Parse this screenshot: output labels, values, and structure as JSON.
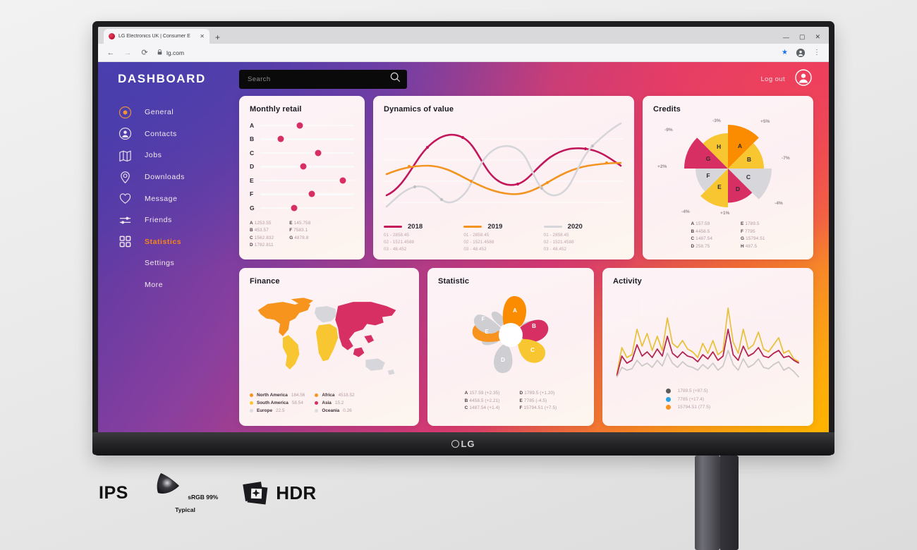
{
  "browser": {
    "tab_title": "LG Electronics UK | Consumer E",
    "tab_close": "✕",
    "new_tab": "+",
    "url": "lg.com",
    "back_icon": "←",
    "forward_icon": "→",
    "reload_icon": "⟳",
    "lock_icon": "🔒",
    "minimize": "—",
    "maximize": "▢",
    "close": "✕",
    "star_icon": "★",
    "menu_icon": "⋮"
  },
  "monitor": {
    "brand": "LG"
  },
  "header": {
    "title": "DASHBOARD",
    "search_placeholder": "Search",
    "search_value": "",
    "search_icon": "search-icon",
    "logout_label": "Log out",
    "avatar_icon": "user-avatar-icon"
  },
  "sidebar": {
    "items": [
      {
        "label": "General",
        "icon": "target-icon",
        "active": false
      },
      {
        "label": "Contacts",
        "icon": "contact-icon",
        "active": false
      },
      {
        "label": "Jobs",
        "icon": "map-icon",
        "active": false
      },
      {
        "label": "Downloads",
        "icon": "pin-icon",
        "active": false
      },
      {
        "label": "Message",
        "icon": "heart-icon",
        "active": false
      },
      {
        "label": "Friends",
        "icon": "sliders-icon",
        "active": false
      },
      {
        "label": "Statistics",
        "icon": "grid-icon",
        "active": true
      },
      {
        "label": "Settings",
        "icon": "none",
        "active": false
      },
      {
        "label": "More",
        "icon": "none",
        "active": false
      }
    ]
  },
  "colors": {
    "crimson": "#d72e63",
    "orange": "#f7931e",
    "orange_bright": "#fb8c00",
    "yellow": "#f8c630",
    "gray": "#cfcfd3",
    "accent_text": "#f98417",
    "activity_yellow": "#e8c13c",
    "activity_crimson": "#b3244f",
    "activity_gray": "#cdc9c9"
  },
  "cards": {
    "retail": {
      "title": "Monthly retail",
      "chart_data": {
        "type": "scatter",
        "title": "Monthly retail",
        "categories": [
          "A",
          "B",
          "C",
          "D",
          "E",
          "F",
          "G"
        ],
        "values": [
          1253.55,
          453.57,
          1562.832,
          1782.811,
          145.758,
          7583.1,
          4878.8
        ],
        "positions_pct": [
          42,
          22,
          62,
          46,
          88,
          55,
          36
        ],
        "xlabel": "",
        "ylabel": "",
        "grid": true
      },
      "legend": [
        [
          {
            "key": "A",
            "value": "1253.55"
          },
          {
            "key": "B",
            "value": "453.57"
          },
          {
            "key": "C",
            "value": "1562.832"
          },
          {
            "key": "D",
            "value": "1782.811"
          }
        ],
        [
          {
            "key": "E",
            "value": "145.758"
          },
          {
            "key": "F",
            "value": "7583.1"
          },
          {
            "key": "G",
            "value": "4878.8"
          }
        ]
      ]
    },
    "dynamics": {
      "title": "Dynamics of value",
      "chart_data": {
        "type": "line",
        "title": "Dynamics of value",
        "x": [
          0,
          1,
          2,
          3,
          4,
          5,
          6,
          7,
          8,
          9,
          10,
          11,
          12
        ],
        "series": [
          {
            "name": "2018",
            "color": "#c2185b",
            "values": [
              18,
              42,
              70,
              86,
              84,
              62,
              38,
              34,
              42,
              62,
              76,
              78,
              66
            ]
          },
          {
            "name": "2019",
            "color": "#f2941f",
            "values": [
              48,
              56,
              55,
              50,
              42,
              32,
              26,
              25,
              30,
              40,
              52,
              62,
              63
            ]
          },
          {
            "name": "2020",
            "color": "#d6d6da",
            "values": [
              8,
              24,
              40,
              34,
              20,
              46,
              74,
              76,
              52,
              26,
              30,
              56,
              92
            ]
          }
        ],
        "grid": true,
        "legend_position": "bottom"
      },
      "legend": [
        {
          "year": "2018",
          "color": "#c2185b",
          "rows": [
            "01 - 2858.45",
            "02 - 1521.4588",
            "03 - 48.452"
          ]
        },
        {
          "year": "2019",
          "color": "#f2941f",
          "rows": [
            "01 - 2858.45",
            "02 - 1521.4588",
            "03 - 48.452"
          ]
        },
        {
          "year": "2020",
          "color": "#d6d6da",
          "rows": [
            "01 - 2858.45",
            "02 - 1521.4588",
            "03 - 48.452"
          ]
        }
      ]
    },
    "credits": {
      "title": "Credits",
      "chart_data": {
        "type": "pie",
        "title": "Credits",
        "labels": [
          "A",
          "B",
          "C",
          "D",
          "E",
          "F",
          "G",
          "H"
        ],
        "values": [
          157.59,
          4458.5,
          1487.54,
          258.75,
          1789.5,
          7795,
          15794.51,
          487.5
        ],
        "percent_labels": [
          "+5%",
          "-7%",
          "-4%",
          "+1%",
          "-4%",
          "+2%",
          "-9%",
          "-3%"
        ],
        "radii_pct": [
          100,
          82,
          100,
          78,
          88,
          74,
          100,
          80
        ],
        "colors": [
          "#fb8c00",
          "#f8c630",
          "#d7d7db",
          "#d72e63",
          "#f8c630",
          "#d7d7db",
          "#d72e63",
          "#f8c630"
        ]
      },
      "legend": [
        [
          {
            "key": "A",
            "value": "157.59"
          },
          {
            "key": "B",
            "value": "4458.5"
          },
          {
            "key": "C",
            "value": "1487.54"
          },
          {
            "key": "D",
            "value": "258.75"
          }
        ],
        [
          {
            "key": "E",
            "value": "1789.5"
          },
          {
            "key": "F",
            "value": "7795"
          },
          {
            "key": "G",
            "value": "15794.51"
          },
          {
            "key": "H",
            "value": "487.5"
          }
        ]
      ]
    },
    "finance": {
      "title": "Finance",
      "chart_data": {
        "type": "map",
        "title": "Finance",
        "regions": [
          "North America",
          "South America",
          "Europe",
          "Africa",
          "Asia",
          "Oceania"
        ],
        "values": [
          184.56,
          58.54,
          22.5,
          4518.52,
          15.2,
          0.26
        ],
        "colors": [
          "#f7941e",
          "#f8c630",
          "#d7d7db",
          "#f8c630",
          "#d72e63",
          "#d7d7db"
        ]
      },
      "legend": [
        [
          {
            "label": "North America",
            "value": "184.56",
            "color": "#f7941e"
          },
          {
            "label": "South America",
            "value": "58.54",
            "color": "#f8c630"
          },
          {
            "label": "Europe",
            "value": "22.5",
            "color": "#d7d7db"
          }
        ],
        [
          {
            "label": "Africa",
            "value": "4518.52",
            "color": "#f7941e"
          },
          {
            "label": "Asia",
            "value": "15.2",
            "color": "#d72e63"
          },
          {
            "label": "Oceania",
            "value": "0.26",
            "color": "#d7d7db"
          }
        ]
      ]
    },
    "statistic": {
      "title": "Statistic",
      "chart_data": {
        "type": "radial",
        "title": "Statistic",
        "labels": [
          "A",
          "B",
          "C",
          "D",
          "E",
          "F"
        ],
        "values": [
          157.59,
          4458.5,
          1487.54,
          1789.5,
          7785,
          15794.51
        ],
        "deltas": [
          "+2.35",
          "+2.21",
          "+1.4",
          "+1.20",
          "-4.5",
          "+7.5"
        ],
        "colors": [
          "#fb8c00",
          "#d72e63",
          "#f8c630",
          "#cfcfd3",
          "#f7931e",
          "#cfcfd3"
        ]
      },
      "legend": [
        [
          {
            "key": "A",
            "value": "157.59 (+2.35)"
          },
          {
            "key": "B",
            "value": "4458.5 (+2.21)"
          },
          {
            "key": "C",
            "value": "1487.54 (+1.4)"
          }
        ],
        [
          {
            "key": "D",
            "value": "1789.5 (+1.20)"
          },
          {
            "key": "E",
            "value": "7785 (-4.5)"
          },
          {
            "key": "F",
            "value": "15794.51 (+7.5)"
          }
        ]
      ]
    },
    "activity": {
      "title": "Activity",
      "chart_data": {
        "type": "line",
        "title": "Activity",
        "series": [
          {
            "name": "15794.51 (77.5)",
            "color": "#e8c13c",
            "values": [
              5,
              32,
              20,
              24,
              58,
              35,
              52,
              30,
              48,
              30,
              72,
              40,
              36,
              44,
              34,
              30,
              22,
              40,
              26,
              44,
              24,
              30,
              88,
              38,
              26,
              58,
              30,
              36,
              52,
              30,
              26,
              36,
              44,
              24,
              28,
              18
            ]
          },
          {
            "name": "1789.5 (+87.5)",
            "color": "#b3244f",
            "values": [
              2,
              20,
              12,
              16,
              40,
              24,
              30,
              20,
              34,
              22,
              48,
              28,
              22,
              30,
              24,
              20,
              14,
              26,
              18,
              30,
              16,
              22,
              56,
              26,
              16,
              36,
              20,
              24,
              34,
              20,
              18,
              24,
              30,
              16,
              20,
              12
            ]
          },
          {
            "name": "7785 (+17.4)",
            "color": "#cdc9c9",
            "values": [
              1,
              10,
              6,
              8,
              18,
              12,
              16,
              10,
              18,
              12,
              26,
              14,
              10,
              16,
              12,
              10,
              6,
              13,
              9,
              16,
              8,
              11,
              30,
              13,
              8,
              19,
              10,
              12,
              18,
              10,
              9,
              12,
              16,
              6,
              9,
              2
            ]
          }
        ],
        "grid": true
      },
      "legend": [
        {
          "value": "1789.5  (+87.5)",
          "color": "#5b5b5b"
        },
        {
          "value": "7785 (+17.4)",
          "color": "#2aa3e0"
        },
        {
          "value": "15794.51 (77.5)",
          "color": "#f7931e"
        }
      ]
    }
  },
  "badges": {
    "ips": "IPS",
    "srgb_line1": "sRGB 99%",
    "srgb_line2": "Typical",
    "hdr": "HDR"
  }
}
